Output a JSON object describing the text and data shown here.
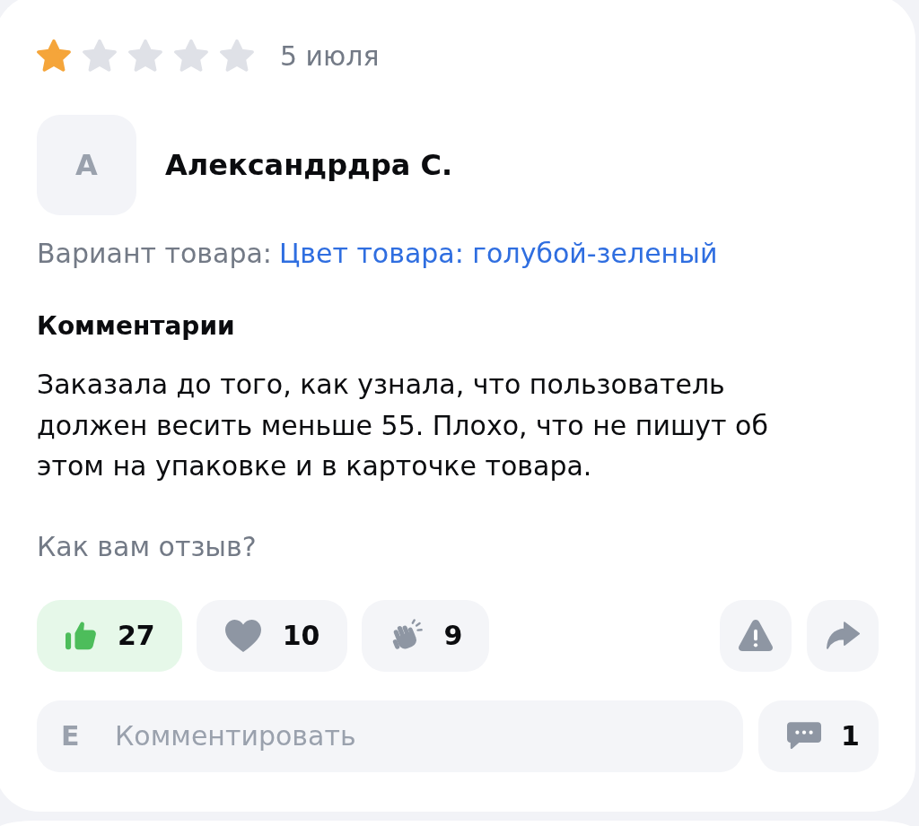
{
  "rating": {
    "stars": 1,
    "date": "5 июля"
  },
  "author": {
    "initial": "А",
    "name": "Александрдра С."
  },
  "variant": {
    "label": "Вариант товара:",
    "value": "Цвет товара: голубой-зеленый"
  },
  "comment": {
    "heading": "Комментарии",
    "text": "Заказала до того, как узнала, что пользователь должен весить меньше 55. Плохо, что не пишут об этом на упаковке и в карточке товара."
  },
  "feedback": {
    "prompt": "Как вам отзыв?",
    "reactions": [
      {
        "kind": "like",
        "count": "27",
        "selected": true
      },
      {
        "kind": "heart",
        "count": "10",
        "selected": false
      },
      {
        "kind": "clap",
        "count": "9",
        "selected": false
      }
    ]
  },
  "comment_box": {
    "initial": "Е",
    "placeholder": "Комментировать"
  },
  "comments_button": {
    "count": "1"
  }
}
